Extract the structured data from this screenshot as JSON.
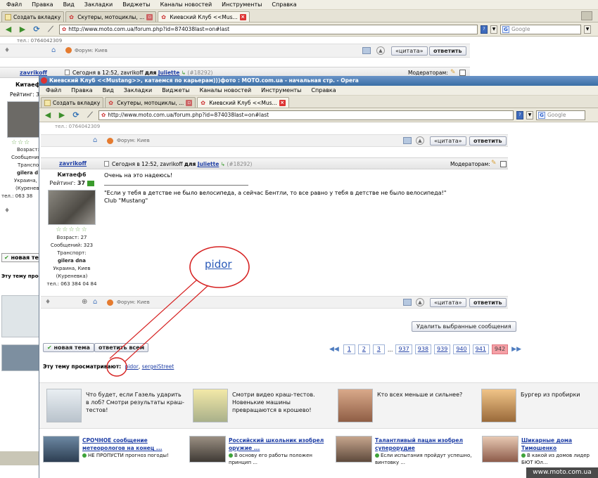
{
  "menu": [
    "Файл",
    "Правка",
    "Вид",
    "Закладки",
    "Виджеты",
    "Каналы новостей",
    "Инструменты",
    "Справка"
  ],
  "tabs": {
    "new_tab": "Создать вкладку",
    "tab1": "Скутеры, мотоциклы, ...",
    "tab2": "Киевский Клуб <<Mus..."
  },
  "address": "http://www.moto.com.ua/forum.php?id=874038last=on#last",
  "search_placeholder": "Google",
  "window_title": "Киевский Клуб <<Mustang>>, катаемся по карьерам)))фото : MOTO.com.ua - начальная стр. - Opera",
  "bg": {
    "phone_partial": "тел.: 0764042309",
    "forum_label": "Форум: Киев",
    "quote_btn": "«цитата»",
    "reply_btn": "ответить",
    "user_partial": "zavrikoff",
    "date_line_prefix": "Сегодня в 12:52, zavrikoff",
    "date_for": "для",
    "to_user": "Juliette",
    "post_num": "(#18292)",
    "moderators": "Модераторам:",
    "side_name_partial": "Китаеф",
    "rating_partial": "Рейтинг: 3",
    "age_partial": "Возраст:",
    "msgs_partial": "Сообщений",
    "transport_partial": "Транспо",
    "bike_partial": "gilera d",
    "city_partial": "Украина, I",
    "district_partial": "(Куреневк",
    "tel_partial": "тел.: 063 38",
    "new_topic_partial": "новая те",
    "viewing_partial": "Эту тему просм"
  },
  "post": {
    "forum_label": "Форум: Киев",
    "quote_btn": "«цитата»",
    "reply_btn": "ответить",
    "username": "zavrikoff",
    "date_line_prefix": "Сегодня в 12:52, zavrikoff",
    "date_for": "для",
    "to_user": "Juliette",
    "post_num": "(#18292)",
    "moderators": "Модераторам:",
    "display_name": "Китаеф6",
    "rating_label": "Рейтинг:",
    "rating_value": "37",
    "age": "Возраст: 27",
    "messages": "Сообщений: 323",
    "transport_label": "Транспорт:",
    "bike": "gilera dna",
    "city": "Украина, Киев",
    "district": "(Куреневка)",
    "phone": "тел.: 063 384 04 84",
    "body_line1": "Очень на это надеюсь!",
    "quote_line": "\"Если у тебя в детстве не было велосипеда, а сейчас Бентли, то все равно у тебя в детстве не было велосипеда!\"",
    "club_line": "Club \"Mustang\""
  },
  "annotation": "pidor",
  "footer": {
    "delete_btn": "Удалить выбранные сообщения",
    "new_topic": "новая тема",
    "reply_all": "ответить всем",
    "pages": [
      "1",
      "2",
      "3",
      "...",
      "937",
      "938",
      "939",
      "940",
      "941",
      "942"
    ],
    "current_page": "942",
    "viewing_label": "Эту тему просматривают:",
    "viewer1": "pidor",
    "viewer2": "sergeiStreet"
  },
  "teasers": [
    {
      "text": "Что будет, если Газель ударить в лоб? Смотри результаты краш-тестов!"
    },
    {
      "text": "Смотри видео краш-тестов. Новенькие машины превращаются в крошево!"
    },
    {
      "text": "Кто всех меньше и сильнее?"
    },
    {
      "text": "Бургер из пробирки"
    }
  ],
  "news": [
    {
      "title": "СРОЧНОЕ сообщение метеорологов на конец ...",
      "sub": "НЕ ПРОПУСТИ прогноз погоды!"
    },
    {
      "title": "Российский школьник изобрел оружие ...",
      "sub": "В основу его работы положен принцип ..."
    },
    {
      "title": "Талантливый пацан изобрел суперорудие",
      "sub": "Если испытания пройдут успешно, винтовку ..."
    },
    {
      "title": "Шикарные дома Тимошенко",
      "sub": "В какой из домов лидер БЮТ Юл..."
    }
  ],
  "watermark": "www.moto.com.ua",
  "colors": {
    "accent_link": "#1f3fa6",
    "annotation_red": "#d62020",
    "titlebar_blue": "#3a6ea5"
  }
}
